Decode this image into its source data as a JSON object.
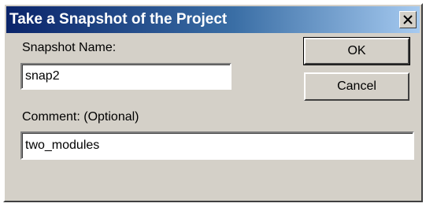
{
  "window": {
    "title": "Take a Snapshot of the Project",
    "close_icon": "close-icon"
  },
  "form": {
    "snapshot_name_label": "Snapshot Name:",
    "snapshot_name_value": "snap2",
    "comment_label": "Comment: (Optional)",
    "comment_value": "two_modules"
  },
  "buttons": {
    "ok_label": "OK",
    "cancel_label": "Cancel"
  },
  "colors": {
    "titlebar_start": "#0a246a",
    "titlebar_end": "#a6caf0",
    "dialog_face": "#d4d0c8"
  }
}
